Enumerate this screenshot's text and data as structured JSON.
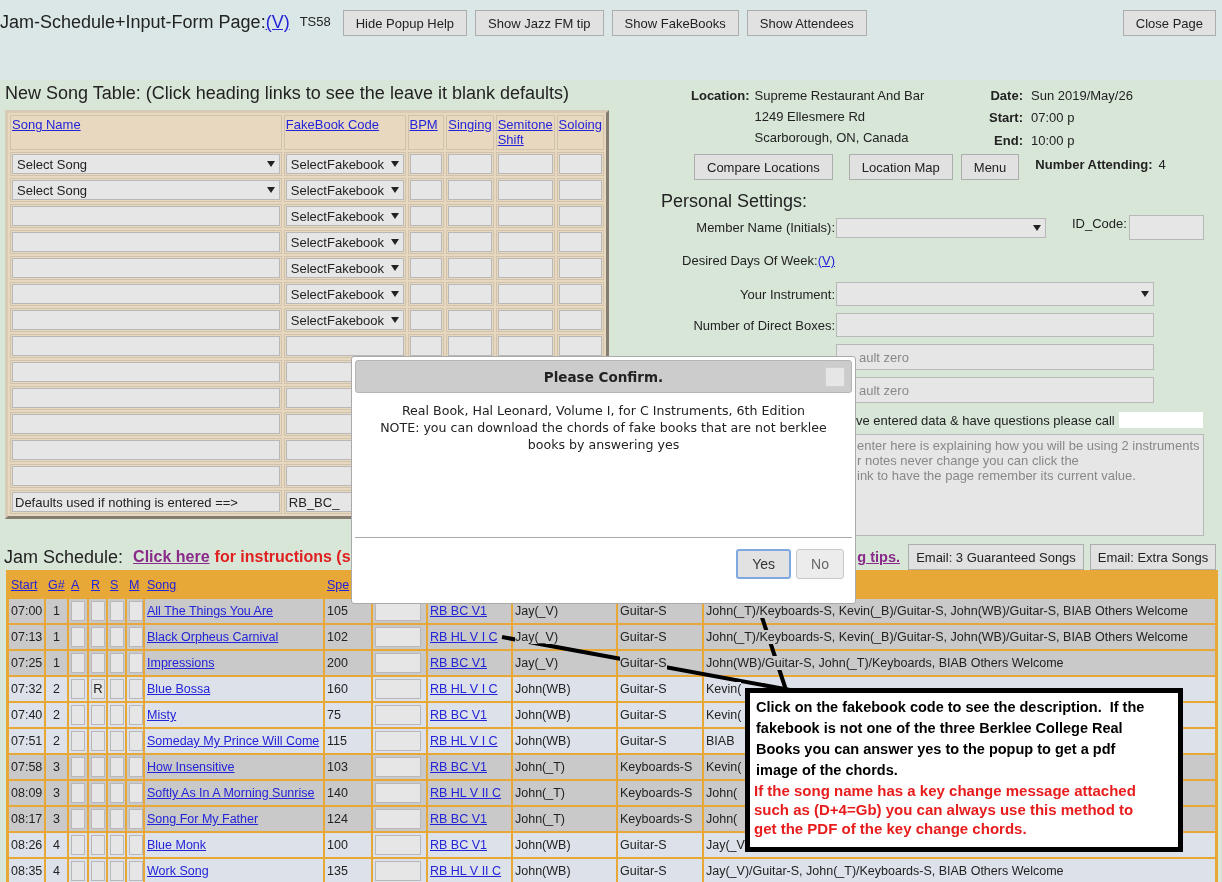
{
  "page_header": {
    "title": "Jam-Schedule+Input-Form Page:",
    "version_link": "(V)",
    "code": "TS58",
    "buttons": [
      "Hide Popup Help",
      "Show Jazz FM tip",
      "Show FakeBooks",
      "Show Attendees"
    ],
    "close_button": "Close Page"
  },
  "song_table": {
    "title": "New Song Table: (Click heading links to see the leave it blank defaults)",
    "columns": [
      "Song Name",
      "FakeBook Code",
      "BPM",
      "Singing",
      "Semitone Shift",
      "Soloing"
    ],
    "rows": [
      {
        "kind": "select",
        "song": "Select Song",
        "fakebook": "SelectFakebook"
      },
      {
        "kind": "select",
        "song": "Select Song",
        "fakebook": "SelectFakebook"
      },
      {
        "kind": "input_select",
        "fakebook": "SelectFakebook"
      },
      {
        "kind": "input_select",
        "fakebook": "SelectFakebook"
      },
      {
        "kind": "input_select",
        "fakebook": "SelectFakebook"
      },
      {
        "kind": "input_select",
        "fakebook": "SelectFakebook"
      },
      {
        "kind": "input_select",
        "fakebook": "SelectFakebook"
      },
      {
        "kind": "input"
      },
      {
        "kind": "covered"
      },
      {
        "kind": "covered"
      },
      {
        "kind": "covered"
      },
      {
        "kind": "covered"
      },
      {
        "kind": "covered"
      },
      {
        "kind": "defaults",
        "song": "Defaults used if nothing is entered ==>",
        "fakebook": "RB_BC_"
      }
    ]
  },
  "event": {
    "location_label": "Location:",
    "location_lines": [
      "Supreme Restaurant And Bar",
      "1249 Ellesmere Rd",
      "Scarborough, ON, Canada"
    ],
    "date_label": "Date:",
    "date": "Sun 2019/May/26",
    "start_label": "Start:",
    "start": "07:00 p",
    "end_label": "End:",
    "end": "10:00 p",
    "buttons": [
      "Compare Locations",
      "Location Map",
      "Menu"
    ],
    "attending_label": "Number Attending:",
    "attending": "4"
  },
  "personal_settings": {
    "title": "Personal Settings:",
    "member_label": "Member Name (Initials):",
    "id_code_label": "ID_Code:",
    "days_label": "Desired Days Of Week:",
    "days_link": "(V)",
    "instrument_label": "Your Instrument:",
    "direct_boxes_label": "Number of Direct Boxes:",
    "covered_fields": [
      {
        "placeholder": "ault zero"
      },
      {
        "placeholder": "ault zero"
      }
    ],
    "contact_note": "ve entered data & have questions please call",
    "notes_placeholder": "enter here is explaining how you will be using 2 instruments\nr notes never change you can click the\nink to have the page remember its current value."
  },
  "jam_schedule": {
    "title": "Jam Schedule:",
    "instructions_link": "Click here",
    "instructions_text": "for instructions (s",
    "tips_link": "g tips.",
    "buttons": [
      "Email: 3 Guaranteed Songs",
      "Email: Extra Songs"
    ],
    "columns": [
      "Start",
      "G#",
      "A",
      "R",
      "S",
      "M",
      "Song",
      "Spe"
    ],
    "rows": [
      {
        "start": "07:00",
        "group": "1",
        "song": "All The Things You Are",
        "speed": "105",
        "fakebook": "RB BC V1",
        "leader": "Jay(_V)",
        "instrument": "Guitar-S",
        "others": "John(_T)/Keyboards-S, Kevin(_B)/Guitar-S, John(WB)/Guitar-S, BIAB Others Welcome",
        "color": "#c9c9c9"
      },
      {
        "start": "07:13",
        "group": "1",
        "song": "Black Orpheus Carnival",
        "speed": "102",
        "fakebook": "RB HL V I C",
        "leader": "Jay(_V)",
        "instrument": "Guitar-S",
        "others": "John(_T)/Keyboards-S, Kevin(_B)/Guitar-S, John(WB)/Guitar-S, BIAB Others Welcome",
        "color": "#c9c9c9"
      },
      {
        "start": "07:25",
        "group": "1",
        "song": "Impressions",
        "speed": "200",
        "fakebook": "RB BC V1",
        "leader": "Jay(_V)",
        "instrument": "Guitar-S",
        "others": "John(WB)/Guitar-S, John(_T)/Keyboards, BIAB Others Welcome",
        "color": "#c9c9c9"
      },
      {
        "start": "07:32",
        "group": "2",
        "r_value": "R",
        "song": "Blue Bossa",
        "speed": "160",
        "fakebook": "RB HL V I C",
        "leader": "John(WB)",
        "instrument": "Guitar-S",
        "others": "Kevin(",
        "color": "#dde2ea"
      },
      {
        "start": "07:40",
        "group": "2",
        "song": "Misty",
        "speed": "75",
        "fakebook": "RB BC V1",
        "leader": "John(WB)",
        "instrument": "Guitar-S",
        "others": "Kevin(",
        "color": "#dde2ea"
      },
      {
        "start": "07:51",
        "group": "2",
        "song": "Someday My Prince Will Come",
        "speed": "115",
        "fakebook": "RB HL V I C",
        "leader": "John(WB)",
        "instrument": "Guitar-S",
        "others": "BIAB",
        "color": "#dde2ea"
      },
      {
        "start": "07:58",
        "group": "3",
        "song": "How Insensitive",
        "speed": "103",
        "fakebook": "RB BC V1",
        "leader": "John(_T)",
        "instrument": "Keyboards-S",
        "others": "Kevin(",
        "color": "#c9c9c9"
      },
      {
        "start": "08:09",
        "group": "3",
        "song": "Softly As In A Morning Sunrise",
        "speed": "140",
        "fakebook": "RB HL V II C",
        "leader": "John(_T)",
        "instrument": "Keyboards-S",
        "others": "John(",
        "color": "#c9c9c9"
      },
      {
        "start": "08:17",
        "group": "3",
        "song": "Song For My Father",
        "speed": "124",
        "fakebook": "RB BC V1",
        "leader": "John(_T)",
        "instrument": "Keyboards-S",
        "others": "John(",
        "color": "#c9c9c9"
      },
      {
        "start": "08:26",
        "group": "4",
        "song": "Blue Monk",
        "speed": "100",
        "fakebook": "RB BC V1",
        "leader": "John(WB)",
        "instrument": "Guitar-S",
        "others": "Jay(_V",
        "color": "#dde2ea"
      },
      {
        "start": "08:35",
        "group": "4",
        "song": "Work Song",
        "speed": "135",
        "fakebook": "RB HL V II C",
        "leader": "John(WB)",
        "instrument": "Guitar-S",
        "others": "Jay(_V)/Guitar-S, John(_T)/Keyboards-S, BIAB Others Welcome",
        "color": "#dde2ea"
      }
    ]
  },
  "dialog": {
    "title": "Please Confirm.",
    "message": "Real Book, Hal Leonard, Volume I, for C Instruments, 6th Edition\nNOTE: you can download the chords of fake books that are not berklee books by answering yes",
    "buttons": [
      {
        "label": "Yes",
        "focused": true,
        "disabled": false
      },
      {
        "label": "No",
        "focused": false,
        "disabled": true
      }
    ]
  },
  "callout": {
    "text": "Click on the fakebook code to see the description.  If the fakebook is not one of the three Berklee College Real Books you can answer yes to the popup to get a pdf image of the chords.",
    "warning": "If the song name has a key change message attached such as (D+4=Gb) you can always use this method to get the PDF of the key change chords."
  }
}
